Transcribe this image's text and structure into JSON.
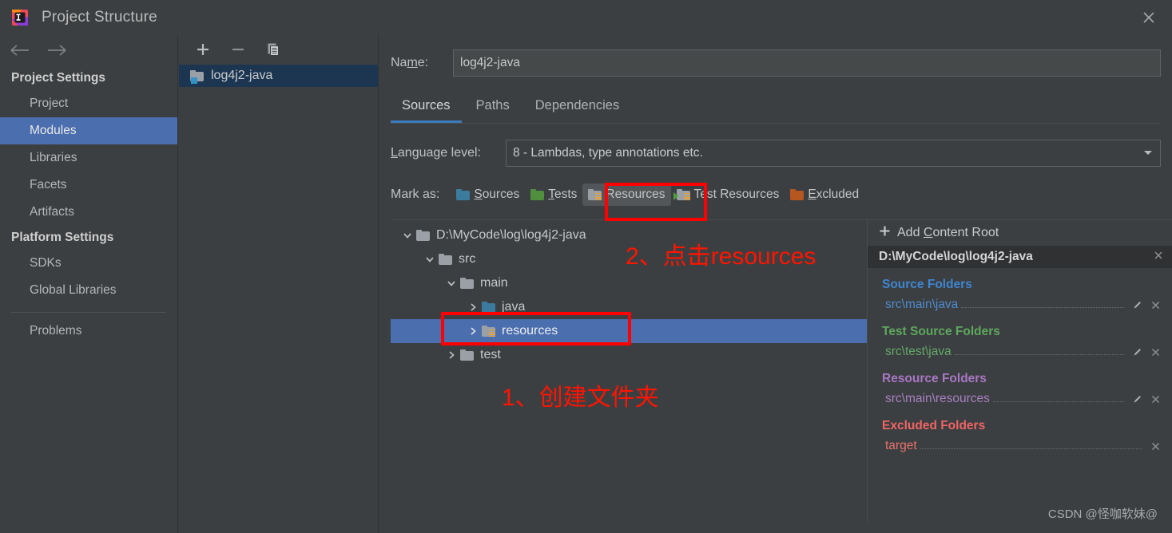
{
  "window": {
    "title": "Project Structure",
    "app_icon": "intellij-idea-icon",
    "close_icon": "close-icon"
  },
  "nav": {
    "back_icon": "arrow-left-icon",
    "forward_icon": "arrow-right-icon"
  },
  "sidebar": {
    "groups": [
      {
        "label": "Project Settings",
        "items": [
          {
            "label": "Project",
            "selected": false
          },
          {
            "label": "Modules",
            "selected": true
          },
          {
            "label": "Libraries",
            "selected": false
          },
          {
            "label": "Facets",
            "selected": false
          },
          {
            "label": "Artifacts",
            "selected": false
          }
        ]
      },
      {
        "label": "Platform Settings",
        "items": [
          {
            "label": "SDKs",
            "selected": false
          },
          {
            "label": "Global Libraries",
            "selected": false
          }
        ]
      }
    ],
    "problems": "Problems"
  },
  "module_panel": {
    "toolbar": [
      {
        "name": "add-button",
        "icon": "plus-icon"
      },
      {
        "name": "remove-button",
        "icon": "minus-icon"
      },
      {
        "name": "copy-button",
        "icon": "copy-icon"
      }
    ],
    "modules": [
      {
        "label": "log4j2-java",
        "selected": true
      }
    ]
  },
  "main": {
    "name_label": "Name:",
    "name_value": "log4j2-java",
    "tabs": [
      {
        "label": "Sources",
        "active": true
      },
      {
        "label": "Paths",
        "active": false
      },
      {
        "label": "Dependencies",
        "active": false
      }
    ],
    "language_level_label": "Language level:",
    "language_level_value": "8 - Lambdas, type annotations etc.",
    "mark_as_label": "Mark as:",
    "mark_as_buttons": [
      {
        "label": "Sources",
        "icon": "folder-blue-icon",
        "hover": false
      },
      {
        "label": "Tests",
        "icon": "folder-green-icon",
        "hover": false
      },
      {
        "label": "Resources",
        "icon": "folder-resources-icon",
        "hover": true
      },
      {
        "label": "Test Resources",
        "icon": "folder-test-resources-icon",
        "hover": false
      },
      {
        "label": "Excluded",
        "icon": "folder-orange-icon",
        "hover": false
      }
    ]
  },
  "tree": [
    {
      "label": "D:\\MyCode\\log\\log4j2-java",
      "depth": 0,
      "expander": "chevron-down-icon",
      "icon": "folder-gray-icon",
      "selected": false
    },
    {
      "label": "src",
      "depth": 1,
      "expander": "chevron-down-icon",
      "icon": "folder-gray-icon",
      "selected": false
    },
    {
      "label": "main",
      "depth": 2,
      "expander": "chevron-down-icon",
      "icon": "folder-gray-icon",
      "selected": false
    },
    {
      "label": "java",
      "depth": 3,
      "expander": "chevron-right-icon",
      "icon": "folder-blue-icon",
      "selected": false
    },
    {
      "label": "resources",
      "depth": 3,
      "expander": "chevron-right-icon",
      "icon": "folder-resources-icon",
      "selected": true
    },
    {
      "label": "test",
      "depth": 2,
      "expander": "chevron-right-icon",
      "icon": "folder-gray-icon",
      "selected": false
    }
  ],
  "right_panel": {
    "add_content_root": "Add Content Root",
    "add_icon": "plus-icon",
    "content_root": "D:\\MyCode\\log\\log4j2-java",
    "content_root_remove_icon": "close-icon",
    "sections": [
      {
        "title": "Source Folders",
        "color": "#3E86D1",
        "rows": [
          {
            "path": "src\\main\\java",
            "edit": true,
            "remove": true
          }
        ]
      },
      {
        "title": "Test Source Folders",
        "color": "#5DA85D",
        "rows": [
          {
            "path": "src\\test\\java",
            "edit": true,
            "remove": true
          }
        ]
      },
      {
        "title": "Resource Folders",
        "color": "#A877C4",
        "rows": [
          {
            "path": "src\\main\\resources",
            "edit": true,
            "remove": true
          }
        ]
      },
      {
        "title": "Excluded Folders",
        "color": "#F06464",
        "rows": [
          {
            "path": "target",
            "edit": false,
            "remove": true
          }
        ]
      }
    ]
  },
  "annotations": [
    {
      "name": "step-1-create-folder",
      "text": "1、创建文件夹"
    },
    {
      "name": "step-2-click-resources",
      "text": "2、点击resources"
    }
  ],
  "watermark": "CSDN @怪咖软妹@",
  "colors": {
    "background": "#3C3F41",
    "selection_blue": "#4B6EAF",
    "module_selection": "#1C3652",
    "tab_underline": "#3D7BBF",
    "annotation_red": "#FF1400"
  }
}
